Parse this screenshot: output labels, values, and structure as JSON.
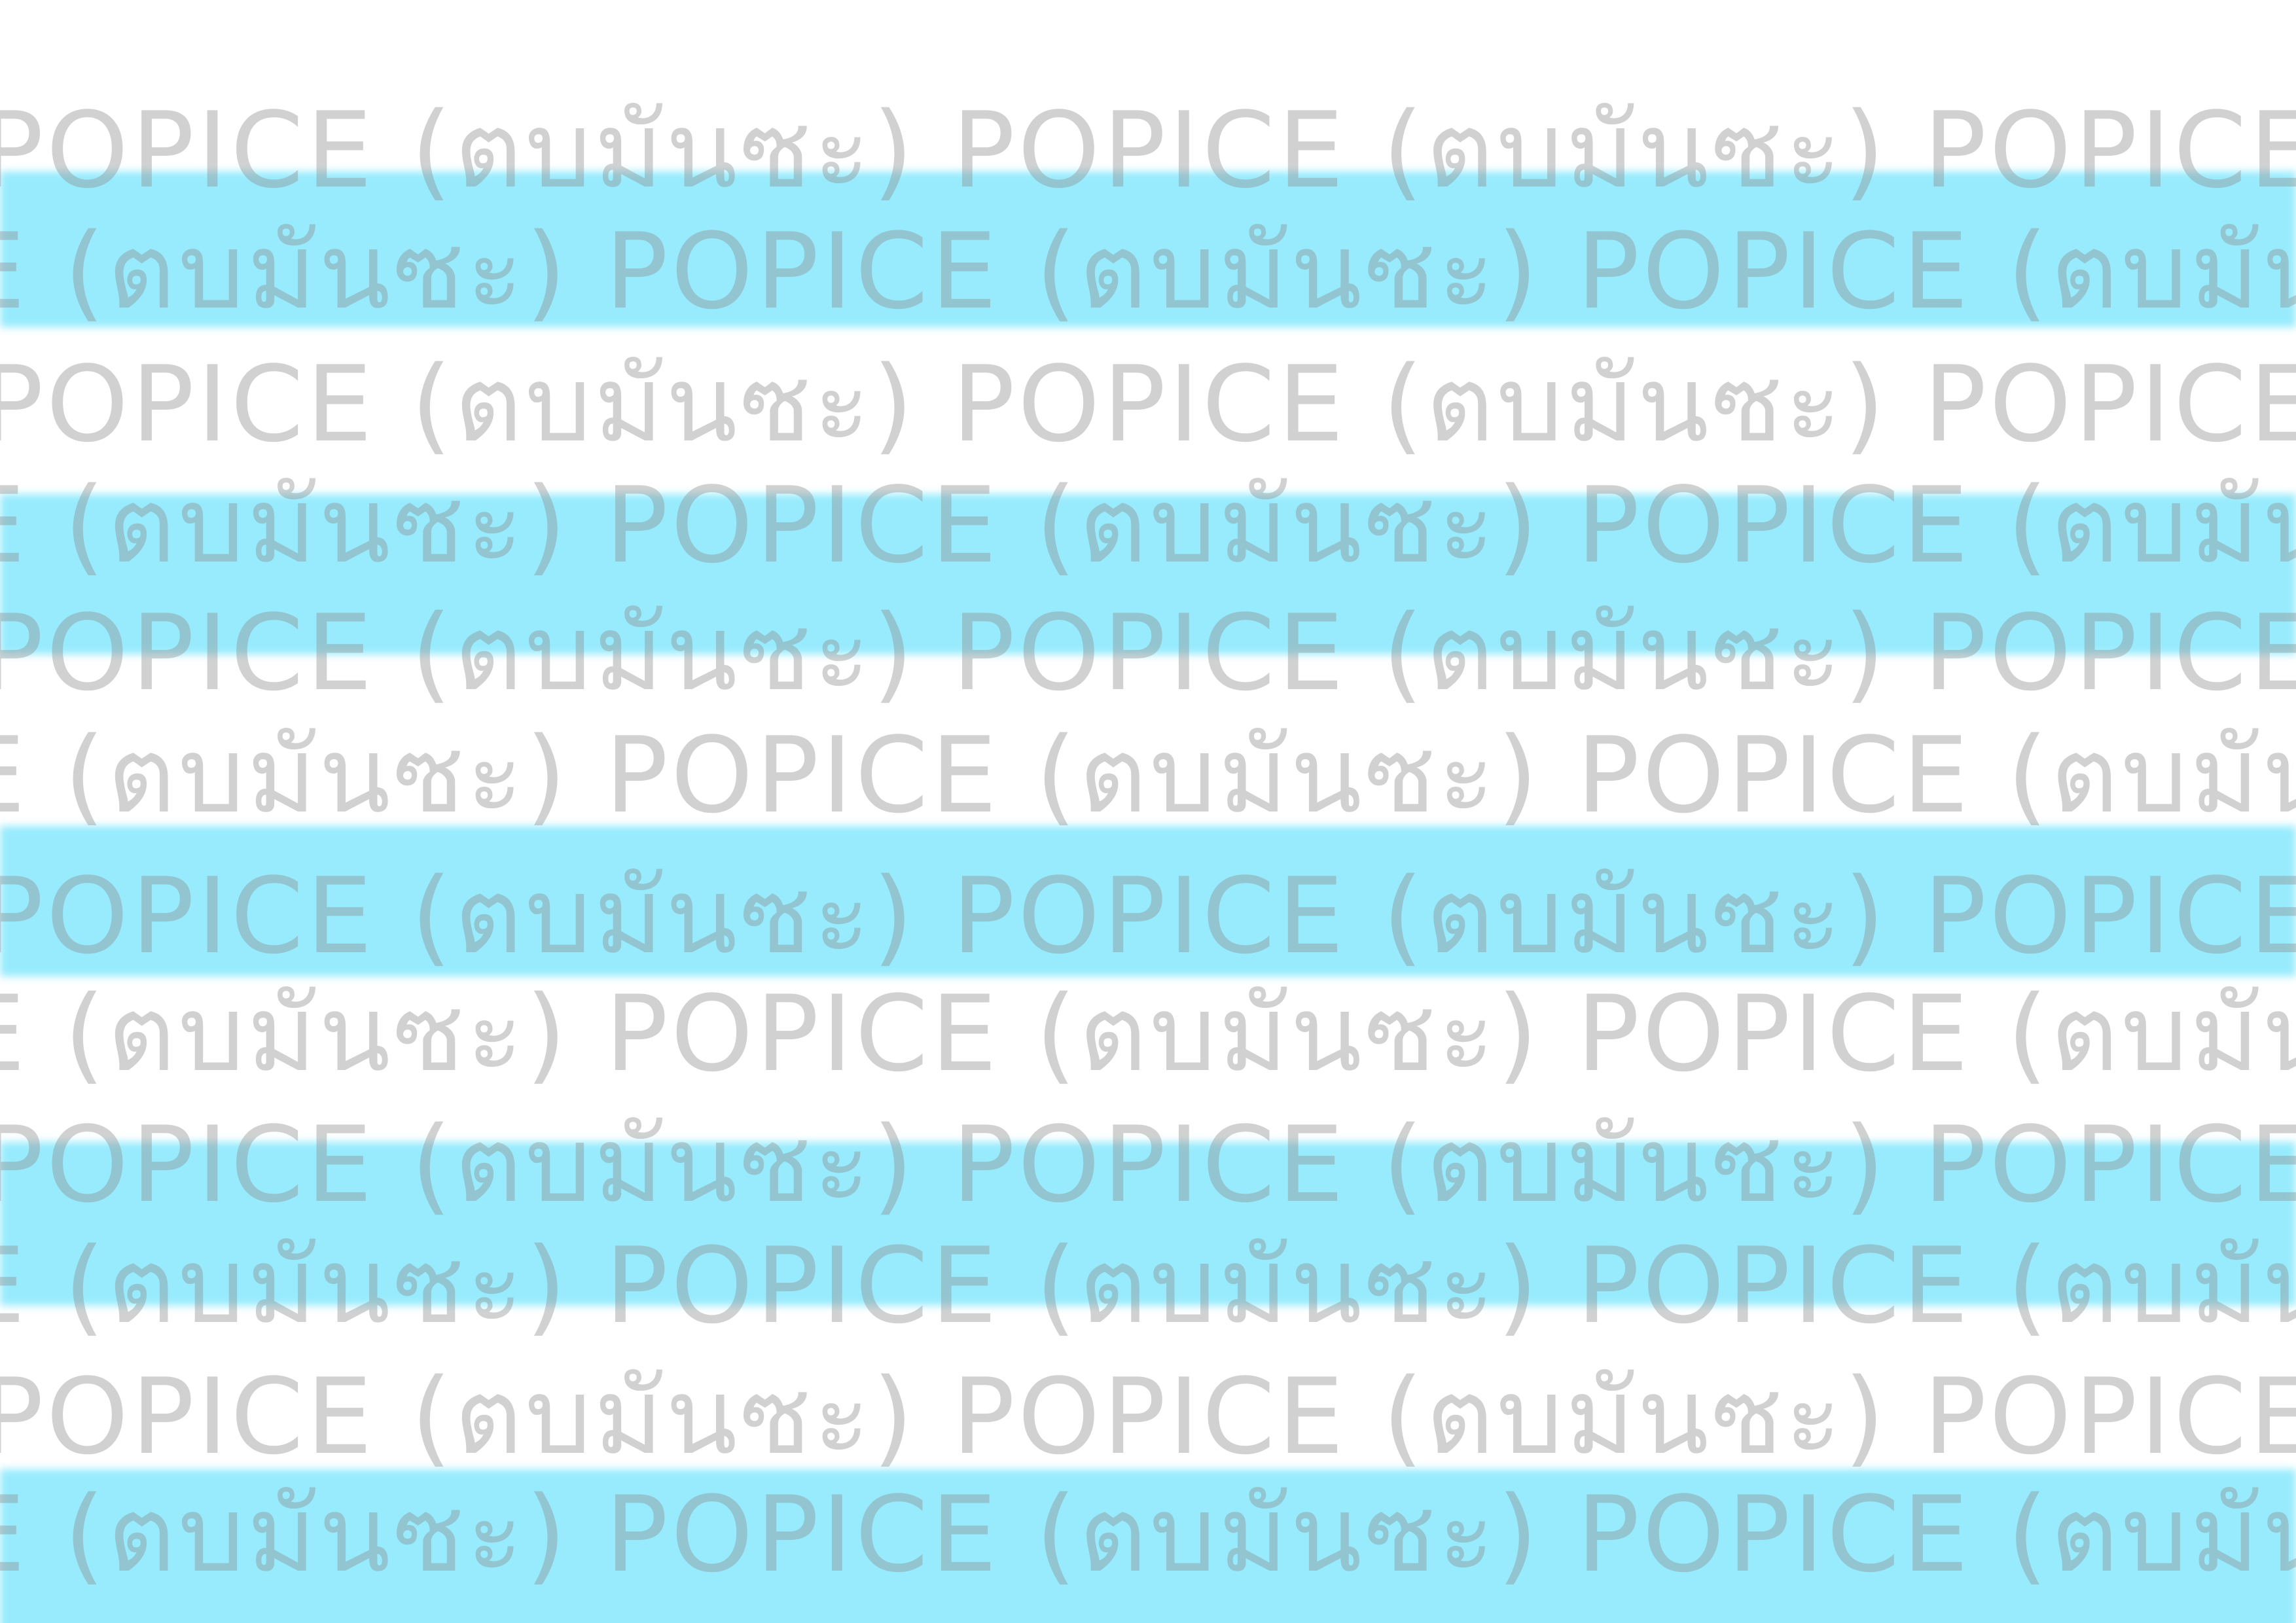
{
  "pattern_text": "POPICE (ตบมันซะ) POPICE (ตบมันซะ) POPICE (ตบมันซะ) POPICE (ตบมันซะ)",
  "colors": {
    "background": "#ffffff",
    "band": "#97ebfd",
    "text": "#8f8f8f",
    "text_opacity": "0.4"
  },
  "rows_count": 12
}
